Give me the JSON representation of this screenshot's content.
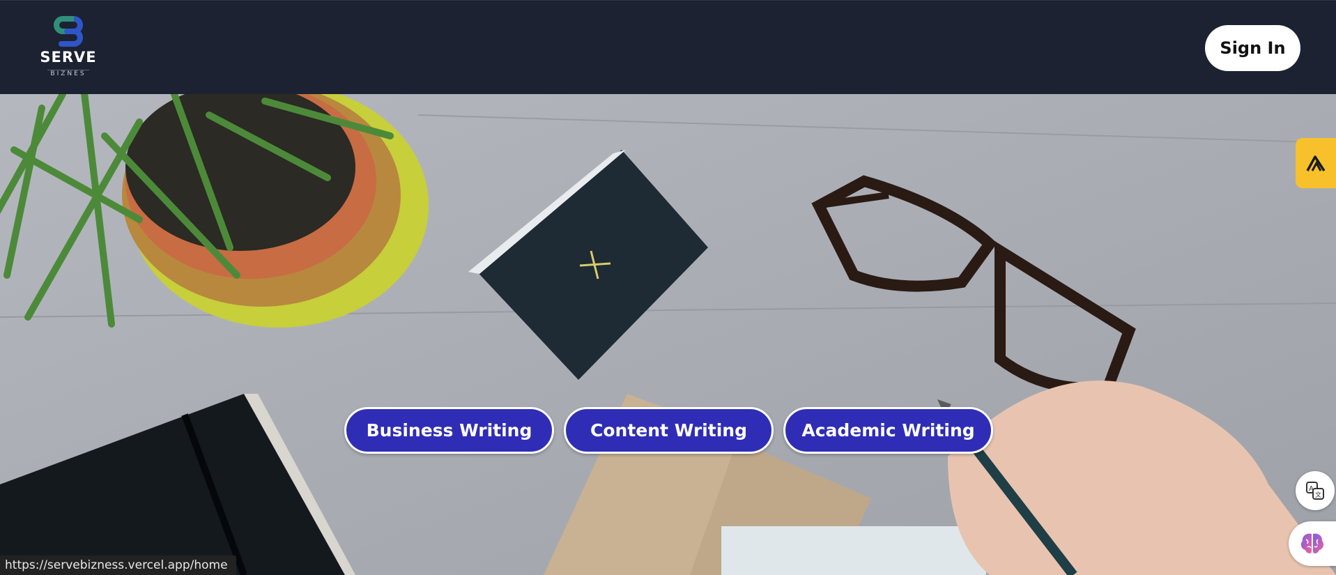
{
  "header": {
    "logo": {
      "brand": "SERVE",
      "sub": "BIZNES",
      "icon": "sb-monogram-icon"
    },
    "sign_in_label": "Sign In"
  },
  "hero": {
    "buttons": [
      {
        "label": "Business Writing"
      },
      {
        "label": "Content Writing"
      },
      {
        "label": "Academic Writing"
      }
    ],
    "button_color": "#2f2db5"
  },
  "widgets": {
    "side_tab_icon": "arrow-logo-icon",
    "translate_icon": "translate-icon",
    "ai_icon": "brain-icon",
    "side_tab_color": "#f8c12b"
  },
  "status_bar": {
    "url": "https://servebizness.vercel.app/home"
  }
}
